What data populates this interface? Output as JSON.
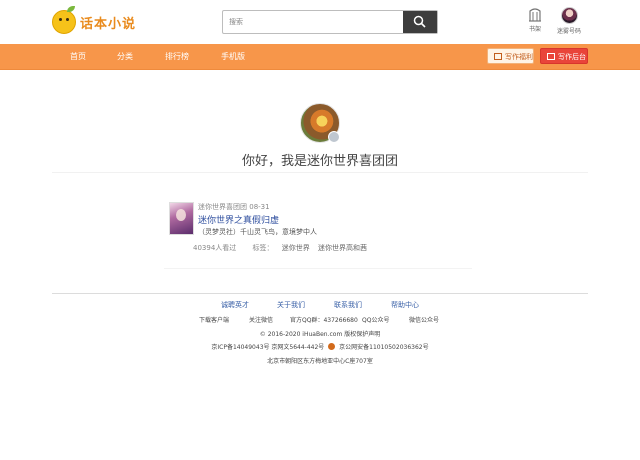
{
  "header": {
    "logo_text": "话本小说",
    "search": {
      "placeholder": "搜索"
    },
    "shelf_label": "书架",
    "user_label": "迷雾号码"
  },
  "nav": {
    "items": [
      "首页",
      "分类",
      "排行榜",
      "手机版"
    ],
    "welfare_button": "写作福利",
    "backend_button": "写作后台"
  },
  "profile": {
    "greeting": "你好，我是迷你世界喜团团"
  },
  "book": {
    "author": "迷你世界喜团团",
    "date": "08-31",
    "title": "迷你世界之真假归虚",
    "description": "（灵梦灵社）千山灵飞鸟，意境梦中人",
    "views": "40394人看过",
    "tags_label": "标签：",
    "tags": [
      "迷你世界",
      "迷你世界高和茜"
    ]
  },
  "footer": {
    "links": [
      "诚聘英才",
      "关于我们",
      "联系我们",
      "帮助中心"
    ],
    "row2": [
      "下载客户端",
      "关注微信",
      "官方QQ群：437266680",
      "QQ公众号",
      "微信公众号"
    ],
    "copyright": "© 2016-2020 iHuaBen.com 版权保护声明",
    "icp": "京ICP备14049043号 京网文5644-442号",
    "police": "京公网安备11010502036362号",
    "address": "北京市朝阳区东方梅地亚中心C座707室"
  },
  "colors": {
    "nav_orange": "#f7964a",
    "backend_red": "#e9443a",
    "link_blue": "#3b62a8"
  }
}
